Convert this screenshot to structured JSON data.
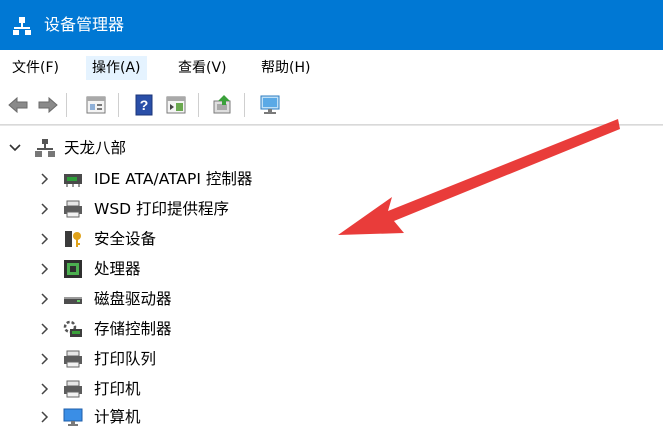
{
  "window": {
    "title": "设备管理器"
  },
  "menu": [
    "文件(F)",
    "操作(A)",
    "查看(V)",
    "帮助(H)"
  ],
  "tree": {
    "root": "天龙八部",
    "items": [
      {
        "label": "IDE ATA/ATAPI 控制器",
        "icon": "ide-controller-icon"
      },
      {
        "label": "WSD 打印提供程序",
        "icon": "printer-icon"
      },
      {
        "label": "安全设备",
        "icon": "security-key-icon"
      },
      {
        "label": "处理器",
        "icon": "processor-icon"
      },
      {
        "label": "磁盘驱动器",
        "icon": "disk-drive-icon"
      },
      {
        "label": "存储控制器",
        "icon": "storage-controller-icon"
      },
      {
        "label": "打印队列",
        "icon": "printer-icon"
      },
      {
        "label": "打印机",
        "icon": "printer-icon"
      },
      {
        "label": "计算机",
        "icon": "computer-monitor-icon"
      }
    ]
  },
  "colors": {
    "titlebar": "#0078d4",
    "annotation_arrow": "#e8312f"
  }
}
